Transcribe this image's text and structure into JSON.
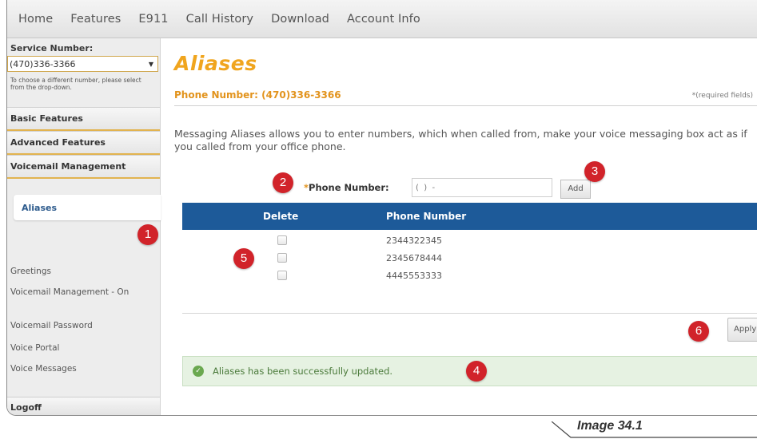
{
  "topnav": {
    "items": [
      "Home",
      "Features",
      "E911",
      "Call History",
      "Download",
      "Account Info"
    ]
  },
  "sidebar": {
    "service_label": "Service Number:",
    "service_value": "(470)336-3366",
    "help_text": "To choose a different number, please select from the drop-down.",
    "sections": [
      "Basic Features",
      "Advanced Features",
      "Voicemail Management"
    ],
    "active_item": "Aliases",
    "links": [
      "Greetings",
      "Voicemail Management - On",
      "Voicemail Password",
      "Voice Portal",
      "Voice Messages"
    ],
    "logoff": "Logoff"
  },
  "main": {
    "title": "Aliases",
    "phone_heading": "Phone Number: (470)336-3366",
    "required_note": "*(required fields)",
    "description": "Messaging Aliases allows you to enter numbers, which when called from, make your voice messaging box act as if you called from your office phone.",
    "form": {
      "required_mark": "*",
      "label": "Phone Number:",
      "input_placeholder": "(  )  -",
      "add_label": "Add"
    },
    "table": {
      "headers": [
        "Delete",
        "Phone Number"
      ],
      "rows": [
        "2344322345",
        "2345678444",
        "4445553333"
      ]
    },
    "apply_label": "Apply",
    "success_message": "Aliases has been successfully updated."
  },
  "callouts": [
    "1",
    "2",
    "3",
    "4",
    "5",
    "6"
  ],
  "caption": "Image 34.1",
  "colors": {
    "accent_orange": "#f0a51e",
    "table_header": "#1d5a99",
    "callout_red": "#d1232a",
    "success_bg": "#e6f2e2"
  }
}
